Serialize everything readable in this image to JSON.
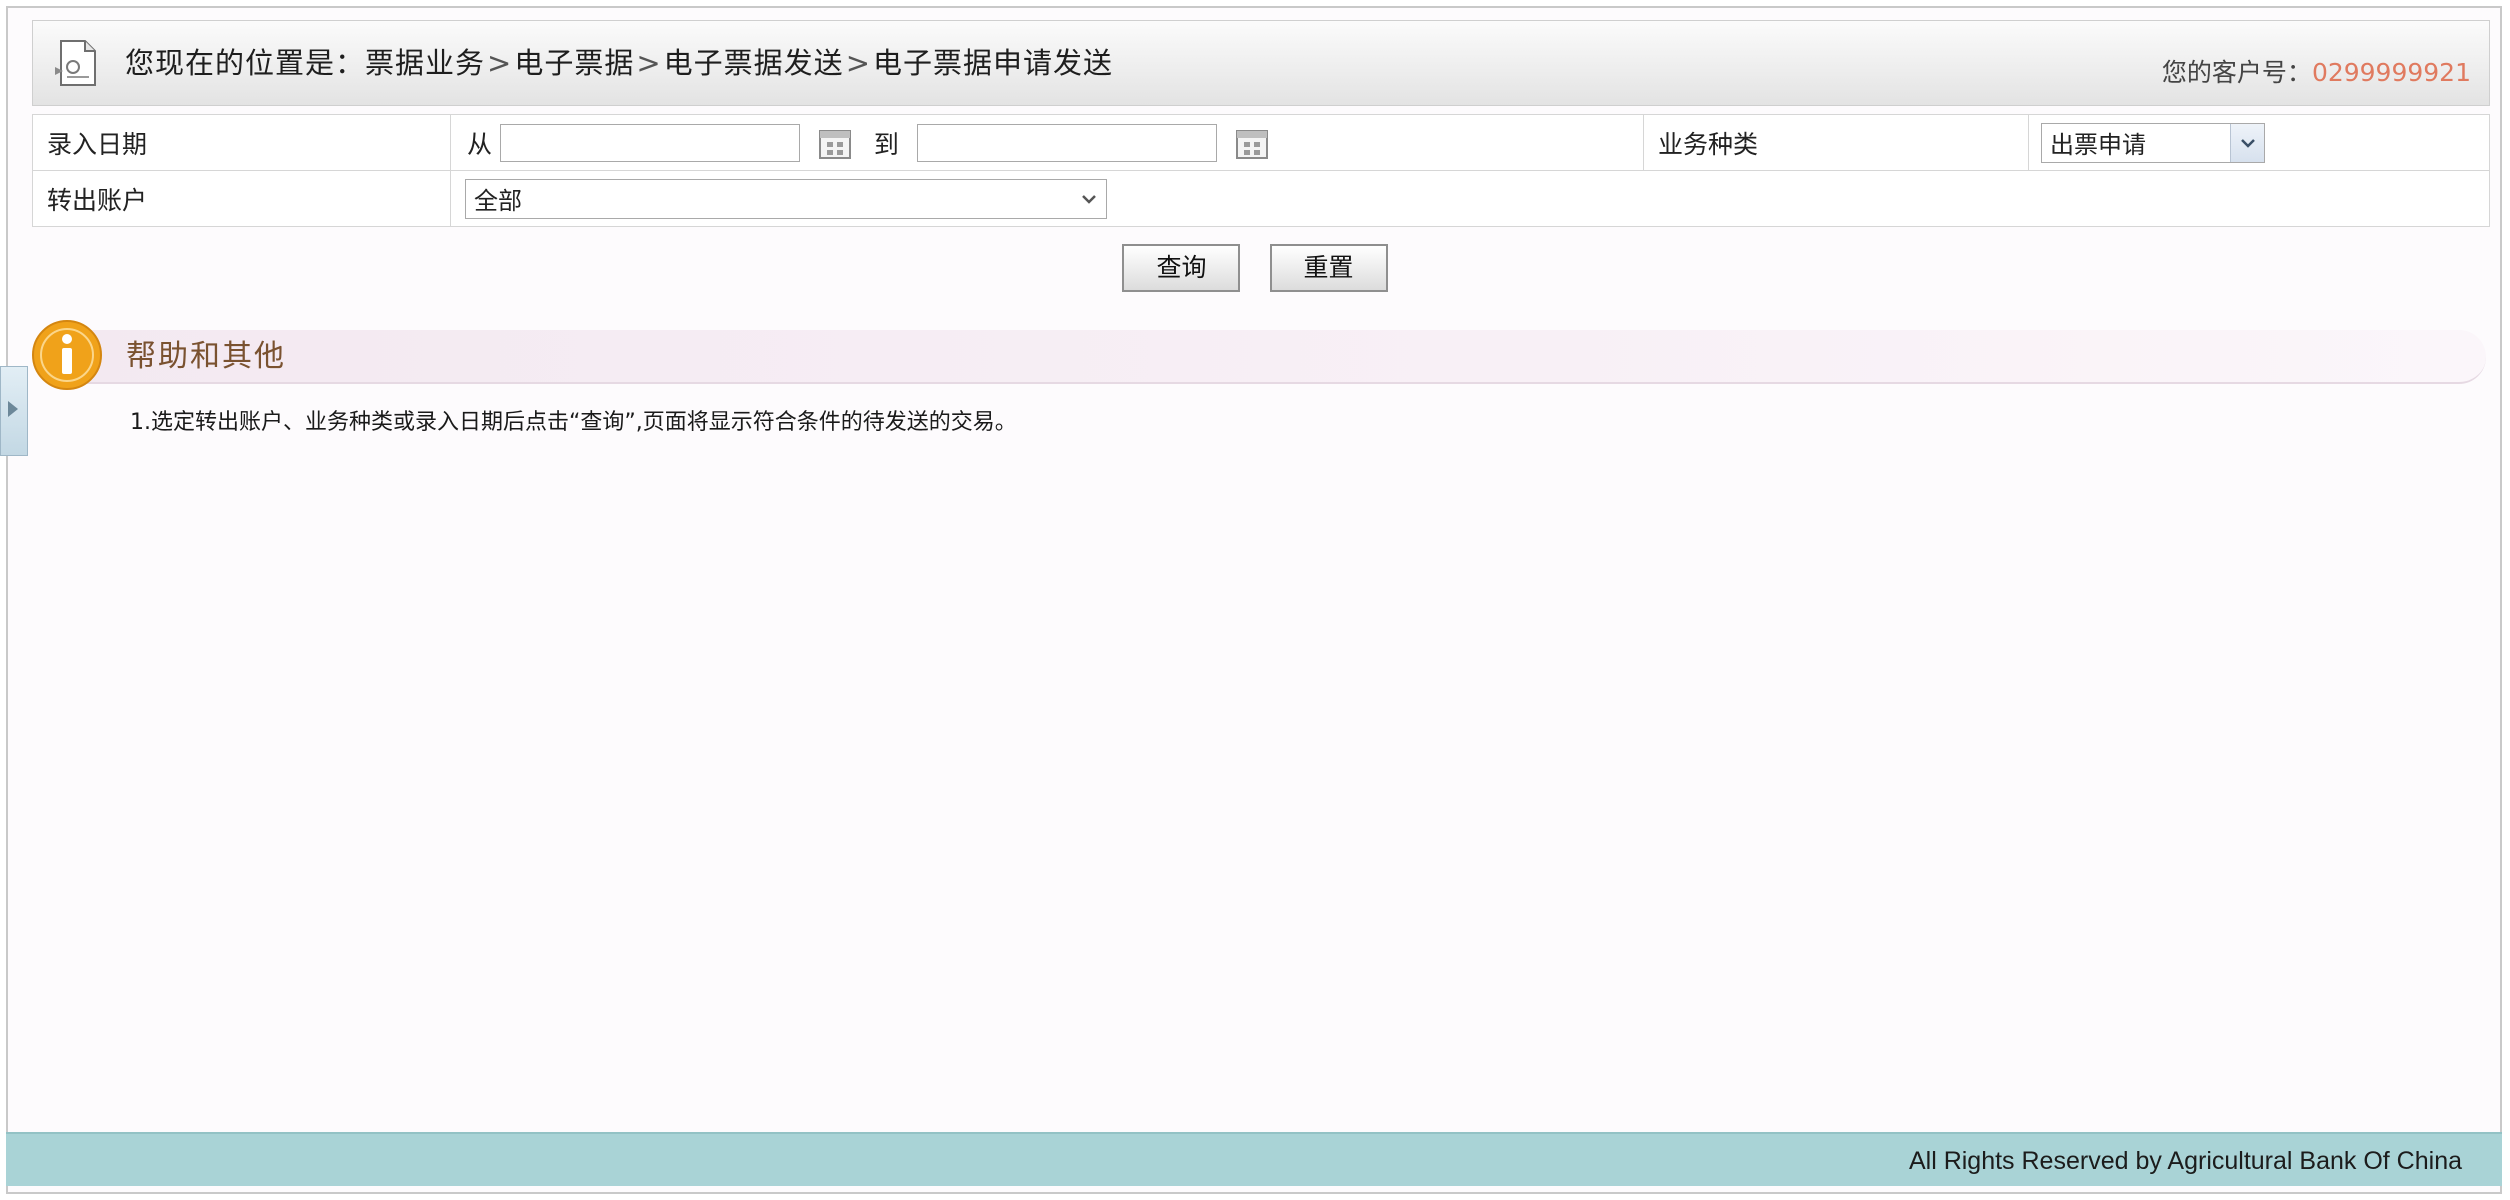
{
  "header": {
    "location_prefix": "您现在的位置是：",
    "breadcrumb": [
      "票据业务",
      "电子票据",
      "电子票据发送",
      "电子票据申请发送"
    ],
    "separator": ">",
    "customer_label": "您的客户号：",
    "customer_no": "0299999921"
  },
  "form": {
    "entry_date_label": "录入日期",
    "from_label": "从",
    "to_label": "到",
    "from_value": "",
    "to_value": "",
    "business_type_label": "业务种类",
    "business_type_value": "出票申请",
    "out_account_label": "转出账户",
    "out_account_value": "全部"
  },
  "buttons": {
    "query": "查询",
    "reset": "重置"
  },
  "help": {
    "title": "帮助和其他",
    "text": "1.选定转出账户、业务种类或录入日期后点击“查询”,页面将显示符合条件的待发送的交易。"
  },
  "footer": {
    "copyright": "All Rights Reserved by Agricultural Bank Of China"
  },
  "icons": {
    "page": "document-icon",
    "calendar": "calendar-icon",
    "info": "info-icon",
    "dropdown": "chevron-down-icon",
    "side_toggle": "chevron-right-icon"
  },
  "colors": {
    "customer_no": "#e07a5f",
    "help_title": "#7a5230",
    "footer_bg": "#a9d3d6",
    "info_icon": "#f0a21a"
  }
}
